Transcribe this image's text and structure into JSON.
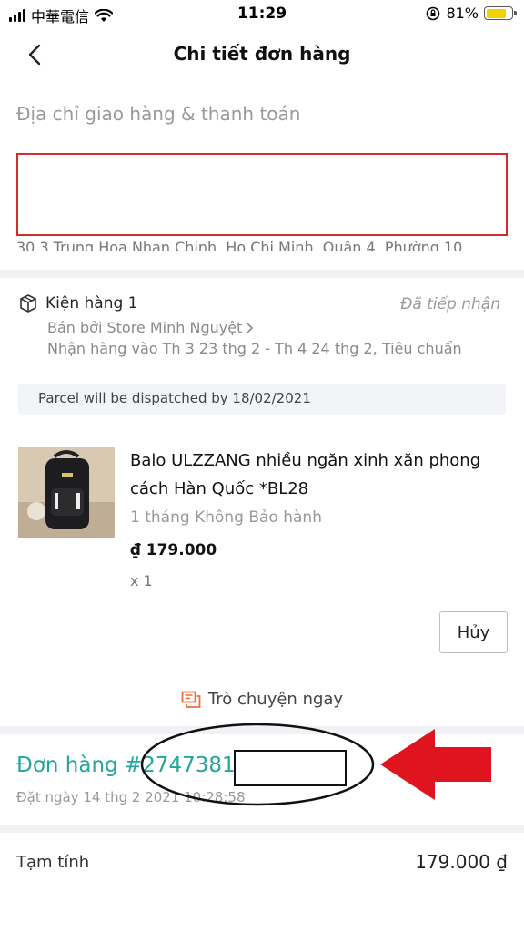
{
  "status_bar": {
    "carrier": "中華電信",
    "time": "11:29",
    "battery_percent": "81%",
    "battery_level": 0.81,
    "battery_color": "#f2d300"
  },
  "nav": {
    "title": "Chi tiết đơn hàng",
    "back_icon": "chevron-left-icon"
  },
  "address": {
    "heading": "Địa chỉ giao hàng & thanh toán",
    "partial_line": "30 3 Trung Hoa Nhan Chinh, Ho Chi Minh, Quận 4, Phường 10"
  },
  "package": {
    "title": "Kiện hàng 1",
    "status": "Đã tiếp nhận",
    "seller": "Bán bởi Store Minh Nguyệt",
    "delivery": "Nhận hàng vào Th 3 23 thg 2 - Th 4 24 thg 2, Tiêu chuẩn",
    "dispatch_note": "Parcel  will be dispatched by 18/02/2021",
    "icon": "package-icon"
  },
  "product": {
    "name": "Balo ULZZANG nhiều ngăn xinh xăn phong cách Hàn Quốc *BL28",
    "warranty": "1 tháng Không Bảo hành",
    "price": "₫ 179.000",
    "quantity": "x 1",
    "cancel_label": "Hủy"
  },
  "chat": {
    "label": "Trò chuyện ngay",
    "icon": "chat-icon",
    "icon_color": "#f26b3a"
  },
  "order": {
    "number": "Đơn hàng #2747381",
    "date": "Đặt ngày 14 thg 2 2021  10:28:58",
    "accent_color": "#26a69a"
  },
  "summary": {
    "subtotal_label": "Tạm tính",
    "subtotal_value": "179.000 ₫"
  },
  "annotations": {
    "highlight_box_color": "#d42a2a",
    "arrow_color": "#e0141e",
    "ellipse_color": "#111111"
  }
}
